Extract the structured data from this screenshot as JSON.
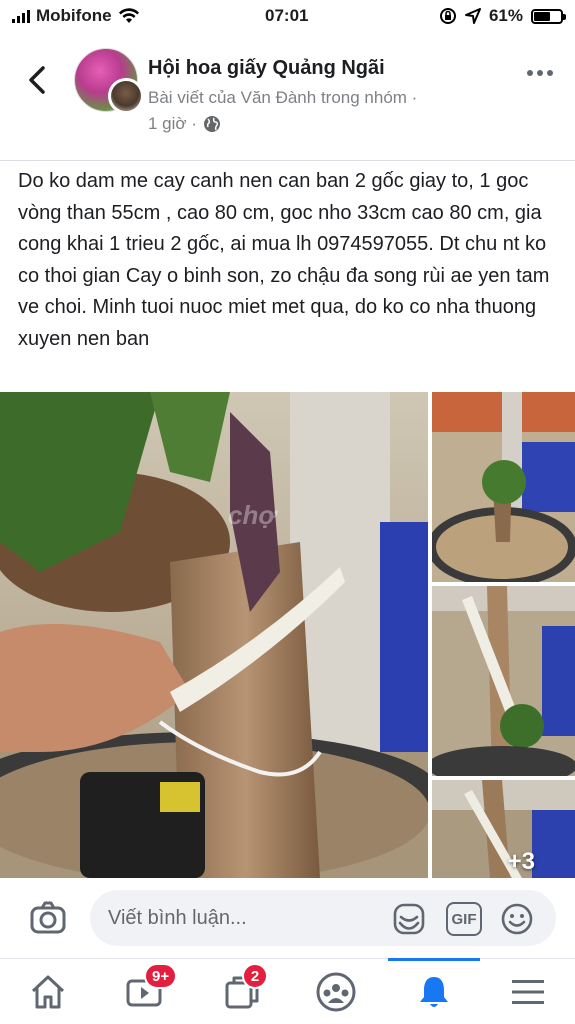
{
  "status_bar": {
    "carrier": "Mobifone",
    "time": "07:01",
    "battery_percent": "61%",
    "battery_level": 0.61
  },
  "header": {
    "group_name": "Hội hoa giấy Quảng Ngãi",
    "subtitle": "Bài viết của Văn Đành trong nhóm ·",
    "timestamp": "1 giờ ·",
    "icons": {
      "back": "chevron-left-icon",
      "privacy": "globe-icon",
      "more": "more-icon"
    }
  },
  "post": {
    "text": "Do ko dam me cay canh nen can ban 2 gốc giay to, 1 goc vòng than 55cm , cao 80 cm, goc nho 33cm cao 80 cm, gia cong khai 1 trieu 2 gốc,  ai mua lh 0974597055. Dt chu nt ko co thoi gian Cay o binh son, zo chậu đa song rùi ae yen tam ve choi. Minh tuoi nuoc miet met qua, do ko co nha thuong xuyen nen ban",
    "more_photos": "+3",
    "watermark": "chợ"
  },
  "comment_bar": {
    "placeholder": "Viết bình luận...",
    "gif_label": "GIF"
  },
  "bottom_nav": {
    "video_badge": "9+",
    "groups_badge": "2",
    "active_tab": "notifications"
  },
  "colors": {
    "accent": "#1877f2",
    "badge": "#e41e3f",
    "muted_text": "#65676b"
  }
}
